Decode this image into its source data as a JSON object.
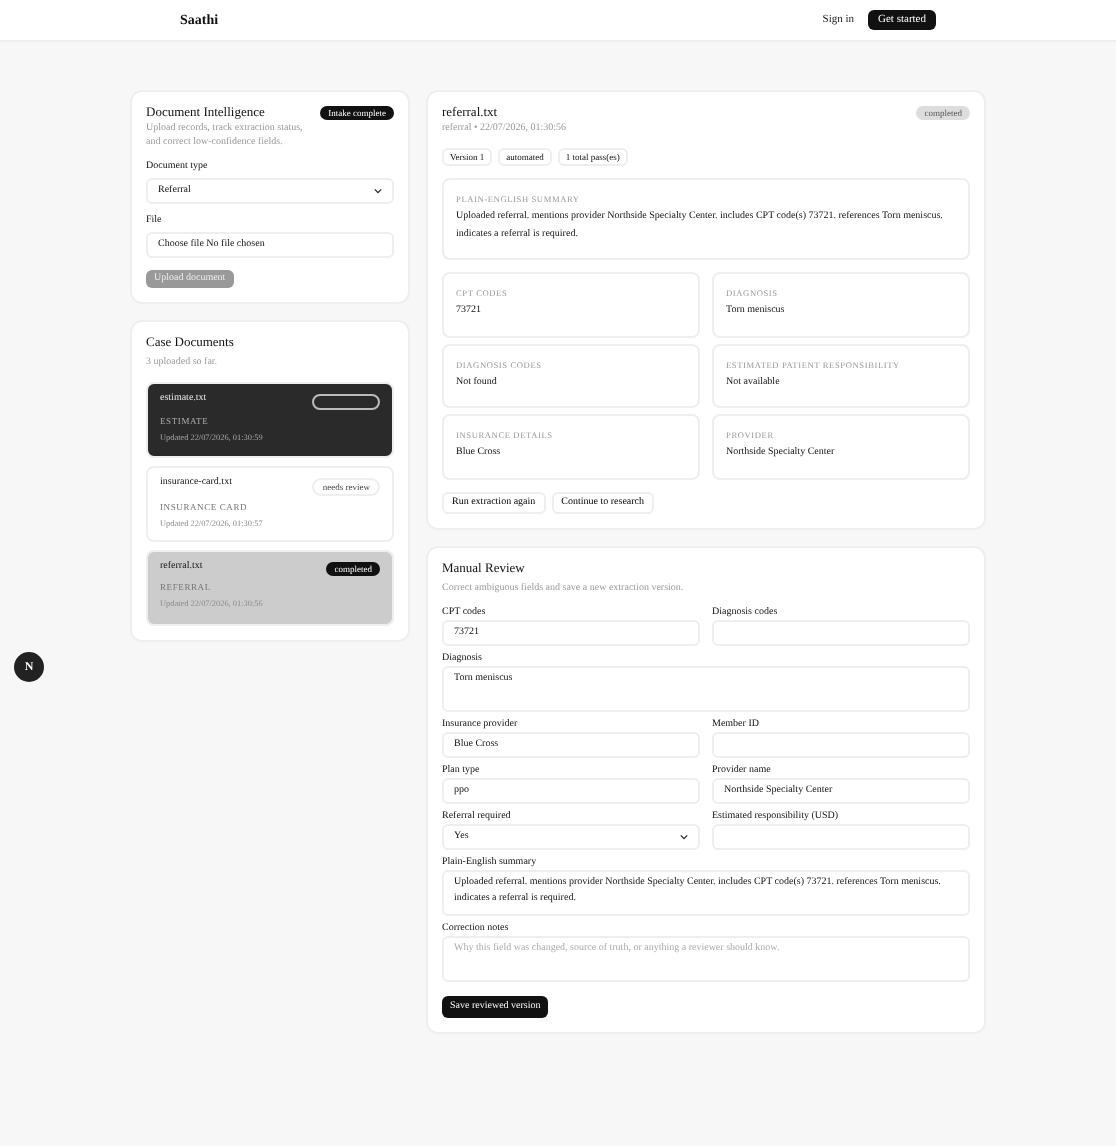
{
  "header": {
    "brand": "Saathi",
    "sign_in": "Sign in",
    "get_started": "Get started"
  },
  "intake": {
    "title": "Document Intelligence",
    "subtitle": "Upload records, track extraction status, and correct low-confidence fields.",
    "badge": "Intake complete",
    "document_type": {
      "label": "Document type",
      "value": "Referral"
    },
    "file": {
      "label": "File",
      "button": "Choose file",
      "status": "No file chosen"
    },
    "upload_button": {
      "label": "Upload document",
      "disabled": true
    }
  },
  "case_documents": {
    "title": "Case Documents",
    "count": "3 uploaded so far.",
    "documents": [
      {
        "name": "estimate.txt",
        "type": "ESTIMATE",
        "updated": "Updated 22/07/2026, 01:30:59",
        "badge": {
          "kind": "outline"
        },
        "selected": false,
        "highlighted": true
      },
      {
        "name": "insurance-card.txt",
        "type": "INSURANCE CARD",
        "updated": "Updated 22/07/2026, 01:30:57",
        "badge": {
          "kind": "light",
          "label": "needs review"
        },
        "selected": false,
        "highlighted": false
      },
      {
        "name": "referral.txt",
        "type": "REFERRAL",
        "updated": "Updated 22/07/2026, 01:30:56",
        "badge": {
          "kind": "dark",
          "label": "completed"
        },
        "selected": true,
        "highlighted": false
      }
    ]
  },
  "detail": {
    "title": "referral.txt",
    "subtitle": "referral • 22/07/2026, 01:30:56",
    "status": "completed",
    "chips": [
      "Version 1",
      "automated",
      "1 total pass(es)"
    ],
    "summary": {
      "label": "PLAIN-ENGLISH SUMMARY",
      "text": "Uploaded referral. mentions provider Northside Specialty Center. includes CPT code(s) 73721. references Torn meniscus. indicates a referral is required."
    },
    "fields": [
      {
        "label": "CPT CODES",
        "value": "73721"
      },
      {
        "label": "DIAGNOSIS",
        "value": "Torn meniscus"
      },
      {
        "label": "DIAGNOSIS CODES",
        "value": "Not found"
      },
      {
        "label": "ESTIMATED PATIENT RESPONSIBILITY",
        "value": "Not available"
      },
      {
        "label": "INSURANCE DETAILS",
        "value": "Blue Cross"
      },
      {
        "label": "PROVIDER",
        "value": "Northside Specialty Center"
      }
    ],
    "actions": [
      "Run extraction again",
      "Continue to research"
    ]
  },
  "review": {
    "title": "Manual Review",
    "subtitle": "Correct ambiguous fields and save a new extraction version.",
    "fields": [
      {
        "kind": "input",
        "full_width": false,
        "label": "CPT codes",
        "value": "73721"
      },
      {
        "kind": "input",
        "full_width": false,
        "label": "Diagnosis codes"
      },
      {
        "kind": "textarea",
        "full_width": true,
        "label": "Diagnosis",
        "value": "Torn meniscus"
      },
      {
        "kind": "input",
        "full_width": false,
        "label": "Insurance provider",
        "value": "Blue Cross"
      },
      {
        "kind": "input",
        "full_width": false,
        "label": "Member ID"
      },
      {
        "kind": "input",
        "full_width": false,
        "label": "Plan type",
        "value": "ppo"
      },
      {
        "kind": "input",
        "full_width": false,
        "label": "Provider name",
        "value": "Northside Specialty Center"
      },
      {
        "kind": "select",
        "full_width": false,
        "label": "Referral required",
        "value": "Yes"
      },
      {
        "kind": "input",
        "full_width": false,
        "label": "Estimated responsibility (USD)"
      },
      {
        "kind": "textarea",
        "full_width": true,
        "label": "Plain-English summary",
        "value": "Uploaded referral. mentions provider Northside Specialty Center. includes CPT code(s) 73721. references Torn meniscus. indicates a referral is required."
      },
      {
        "kind": "textarea",
        "full_width": true,
        "label": "Correction notes",
        "placeholder": "Why this field was changed, source of truth, or anything a reviewer should know."
      }
    ],
    "save_button": "Save reviewed version"
  },
  "fab": "N"
}
